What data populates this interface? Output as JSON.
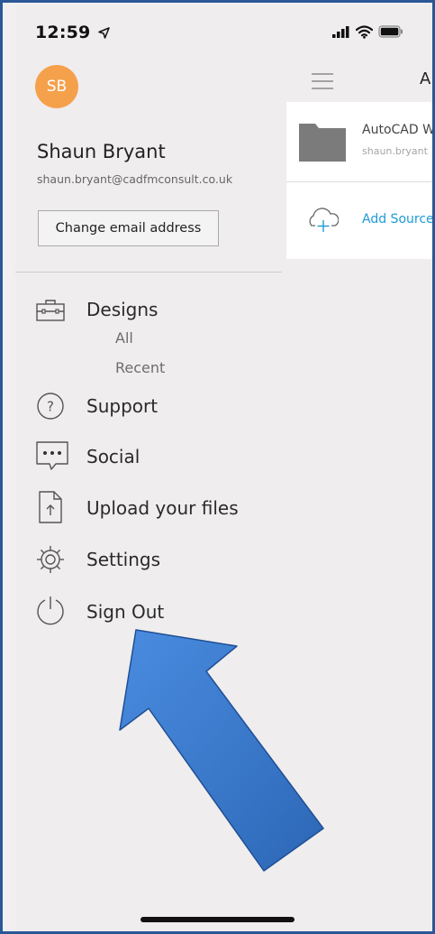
{
  "status_bar": {
    "time": "12:59"
  },
  "menu": {
    "avatar_initials": "SB",
    "user_name": "Shaun Bryant",
    "user_email": "shaun.bryant@cadfmconsult.co.uk",
    "change_email_label": "Change email address",
    "items": [
      {
        "label": "Designs",
        "icon": "briefcase-icon"
      },
      {
        "label": "Support",
        "icon": "help-circle-icon"
      },
      {
        "label": "Social",
        "icon": "chat-bubble-icon"
      },
      {
        "label": "Upload your files",
        "icon": "upload-file-icon"
      },
      {
        "label": "Settings",
        "icon": "gear-icon"
      },
      {
        "label": "Sign Out",
        "icon": "power-icon"
      }
    ],
    "designs_subitems": [
      "All",
      "Recent"
    ]
  },
  "right_panel": {
    "title_fragment": "A",
    "folder": {
      "title": "AutoCAD W",
      "subtitle": "shaun.bryant",
      "icon": "folder-icon"
    },
    "add_source": {
      "label": "Add Source",
      "icon": "cloud-add-icon"
    }
  },
  "colors": {
    "avatar": "#f5a04b",
    "link": "#1e9bd6",
    "annotation_arrow": "#3a78c9",
    "frame_border": "#2b5797"
  }
}
